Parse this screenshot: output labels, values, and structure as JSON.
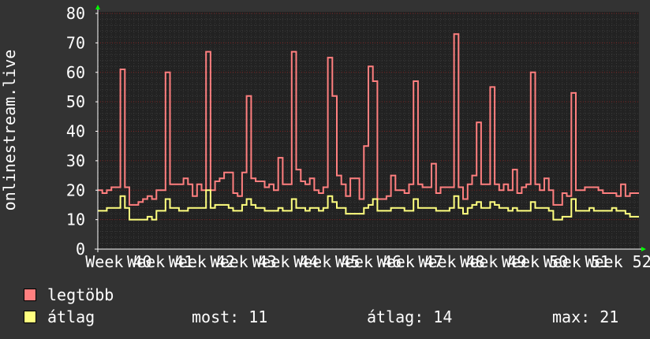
{
  "chart_data": {
    "type": "line",
    "ylabel": "onlinestream.live",
    "xlabel": "",
    "ylim": [
      0,
      80
    ],
    "yticks": [
      0,
      10,
      20,
      30,
      40,
      50,
      60,
      70,
      80
    ],
    "xtick_labels": [
      "Week 40",
      "Week 41",
      "Week 42",
      "Week 43",
      "Week 44",
      "Week 45",
      "Week 46",
      "Week 47",
      "Week 48",
      "Week 49",
      "Week 50",
      "Week 51",
      "Week 52"
    ],
    "grid": true,
    "colors": {
      "background": "#333333",
      "plot_background": "#222222",
      "grid_minor": "#3a3a3a",
      "grid_major": "#7a2020",
      "axis": "#ffffff",
      "arrow": "#00ff00",
      "max_series": "#ff7f7f",
      "avg_series": "#ffff7f"
    },
    "series": [
      {
        "name": "legtöbb",
        "color": "#ff7f7f",
        "values": [
          20,
          19,
          20,
          21,
          21,
          61,
          21,
          15,
          15,
          16,
          17,
          18,
          17,
          20,
          20,
          60,
          22,
          22,
          22,
          24,
          22,
          18,
          22,
          20,
          67,
          20,
          23,
          24,
          26,
          26,
          19,
          18,
          26,
          52,
          24,
          23,
          23,
          21,
          22,
          20,
          31,
          22,
          22,
          67,
          27,
          23,
          22,
          24,
          20,
          19,
          21,
          65,
          52,
          25,
          22,
          18,
          24,
          24,
          17,
          35,
          62,
          57,
          17,
          17,
          18,
          25,
          20,
          20,
          19,
          22,
          57,
          22,
          21,
          21,
          29,
          19,
          21,
          21,
          21,
          73,
          21,
          17,
          22,
          25,
          43,
          22,
          22,
          55,
          22,
          20,
          22,
          20,
          27,
          19,
          21,
          22,
          60,
          22,
          20,
          24,
          20,
          15,
          15,
          19,
          18,
          53,
          20,
          20,
          21,
          21,
          21,
          20,
          19,
          19,
          19,
          18,
          22,
          18,
          19,
          19
        ]
      },
      {
        "name": "átlag",
        "color": "#ffff7f",
        "values": [
          13,
          13,
          14,
          14,
          14,
          18,
          14,
          10,
          10,
          10,
          10,
          11,
          10,
          13,
          13,
          17,
          14,
          14,
          13,
          13,
          14,
          14,
          14,
          14,
          20,
          14,
          15,
          15,
          15,
          14,
          13,
          13,
          15,
          17,
          15,
          14,
          14,
          13,
          13,
          13,
          14,
          13,
          13,
          17,
          14,
          14,
          13,
          14,
          14,
          13,
          14,
          18,
          16,
          14,
          14,
          12,
          12,
          12,
          12,
          14,
          15,
          17,
          13,
          13,
          13,
          14,
          14,
          14,
          13,
          13,
          17,
          14,
          14,
          14,
          14,
          13,
          13,
          13,
          14,
          18,
          14,
          12,
          14,
          15,
          16,
          14,
          14,
          16,
          15,
          14,
          14,
          13,
          14,
          13,
          13,
          13,
          16,
          14,
          14,
          14,
          13,
          10,
          10,
          11,
          11,
          17,
          13,
          13,
          13,
          14,
          13,
          13,
          13,
          13,
          14,
          13,
          13,
          12,
          11,
          11
        ]
      }
    ]
  },
  "legend": {
    "max_label": "legtöbb",
    "avg_label": "átlag"
  },
  "stats": {
    "current": "most: 11",
    "average": "átlag: 14",
    "maximum": "max: 21"
  }
}
